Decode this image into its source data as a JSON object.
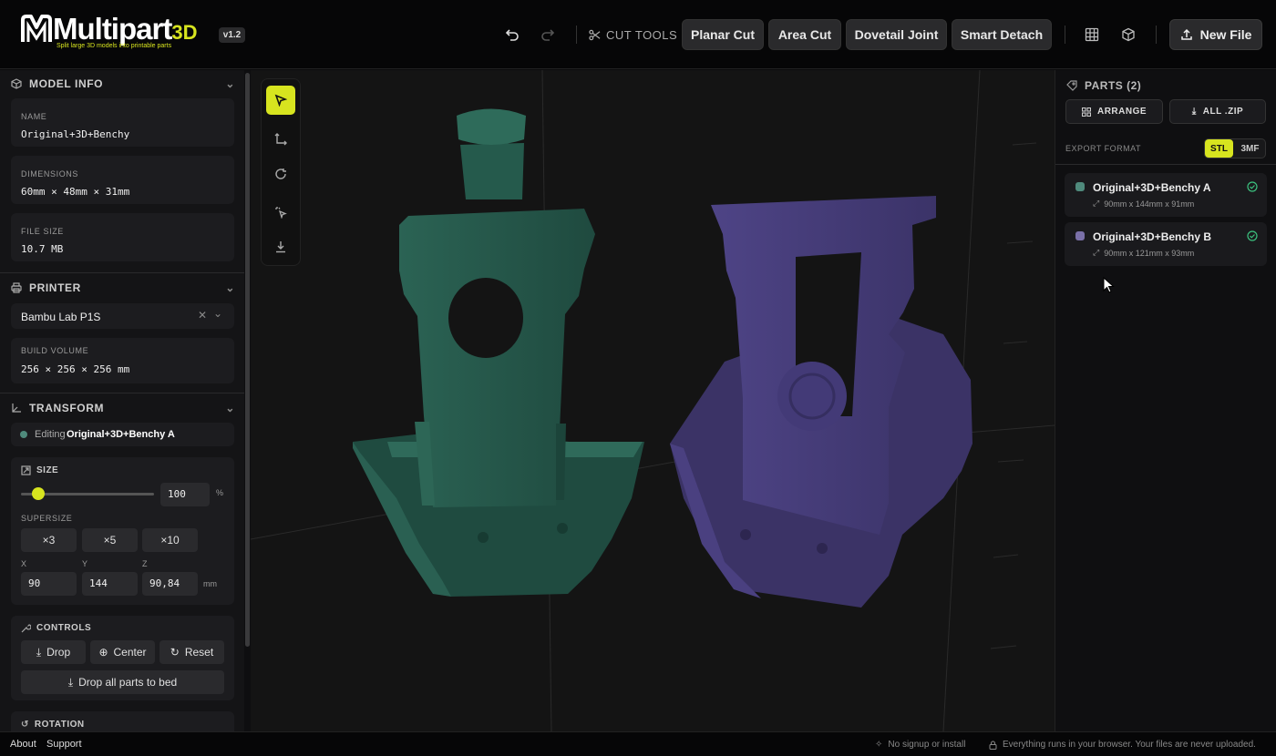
{
  "header": {
    "logo_title_main": "Multipart",
    "logo_title_accent": "3D",
    "logo_subtitle": "Split large 3D models into printable parts",
    "version": "v1.2",
    "cut_tools_label": "CUT TOOLS",
    "buttons": [
      "Planar Cut",
      "Area Cut",
      "Dovetail Joint",
      "Smart Detach"
    ],
    "new_file": "New File"
  },
  "sidebar": {
    "model_info": {
      "title": "MODEL INFO",
      "name_label": "NAME",
      "name": "Original+3D+Benchy",
      "dimensions_label": "DIMENSIONS",
      "dimensions": "60mm × 48mm × 31mm",
      "filesize_label": "FILE SIZE",
      "filesize": "10.7 MB"
    },
    "printer": {
      "title": "PRINTER",
      "selected": "Bambu Lab P1S",
      "build_label": "BUILD VOLUME",
      "build": "256 × 256 × 256 mm"
    },
    "transform": {
      "title": "TRANSFORM",
      "editing_prefix": "Editing",
      "editing_part": "Original+3D+Benchy A",
      "size_label": "SIZE",
      "size_value": "100",
      "size_unit": "%",
      "size_slider_fraction": 0.13,
      "supersize_label": "SUPERSIZE",
      "supersize": [
        "×3",
        "×5",
        "×10"
      ],
      "x_label": "X",
      "x": "90",
      "y_label": "Y",
      "y": "144",
      "z_label": "Z",
      "z": "90,84",
      "dim_unit": "mm"
    },
    "controls": {
      "title": "CONTROLS",
      "drop": "Drop",
      "center": "Center",
      "reset": "Reset",
      "drop_all": "Drop all parts to bed"
    },
    "rotation": {
      "title": "ROTATION"
    }
  },
  "parts": {
    "title": "PARTS (2)",
    "arrange": "ARRANGE",
    "all_zip": "ALL .ZIP",
    "export_label": "EXPORT FORMAT",
    "formats": [
      "STL",
      "3MF"
    ],
    "selected_format": "STL",
    "items": [
      {
        "name": "Original+3D+Benchy A",
        "dims": "90mm x 144mm x 91mm",
        "color": "#2f6b5c"
      },
      {
        "name": "Original+3D+Benchy B",
        "dims": "90mm x 121mm x 93mm",
        "color": "#6a5d9c"
      }
    ]
  },
  "colors": {
    "accent": "#d7e41f",
    "part_a": "#25584b",
    "part_b": "#4a407c",
    "ok": "#3cc27f"
  },
  "footer": {
    "about": "About",
    "support": "Support",
    "note1": "No signup or install",
    "note2": "Everything runs in your browser. Your files are never uploaded."
  }
}
